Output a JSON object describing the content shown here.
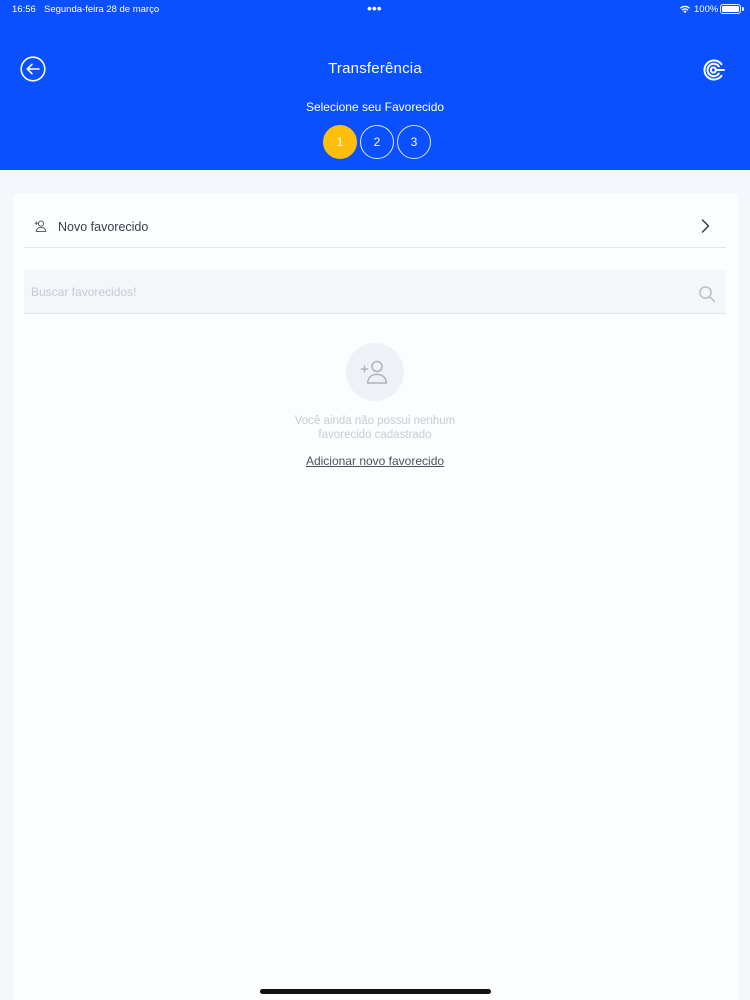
{
  "status_bar": {
    "time": "16:56",
    "date": "Segunda-feira 28 de março",
    "battery": "100%",
    "dots": "•••"
  },
  "header": {
    "title": "Transferência",
    "subtitle": "Selecione seu Favorecido",
    "back_icon": "arrow-left-circle-icon",
    "brand_icon": "brand-logo-icon",
    "background": "#0a50ff",
    "steps": [
      {
        "label": "1",
        "active": true
      },
      {
        "label": "2",
        "active": false
      },
      {
        "label": "3",
        "active": false
      }
    ],
    "active_step_color": "#ffbe0b"
  },
  "new_favorite": {
    "label": "Novo favorecido",
    "icon": "user-icon",
    "chevron": "chevron-right-icon"
  },
  "search": {
    "placeholder": "Buscar favorecidos!",
    "value": "",
    "icon": "search-icon"
  },
  "empty_state": {
    "icon": "add-user-icon",
    "message": "Você ainda não possui nenhum favorecido cadastrado",
    "link": "Adicionar novo favorecido"
  }
}
